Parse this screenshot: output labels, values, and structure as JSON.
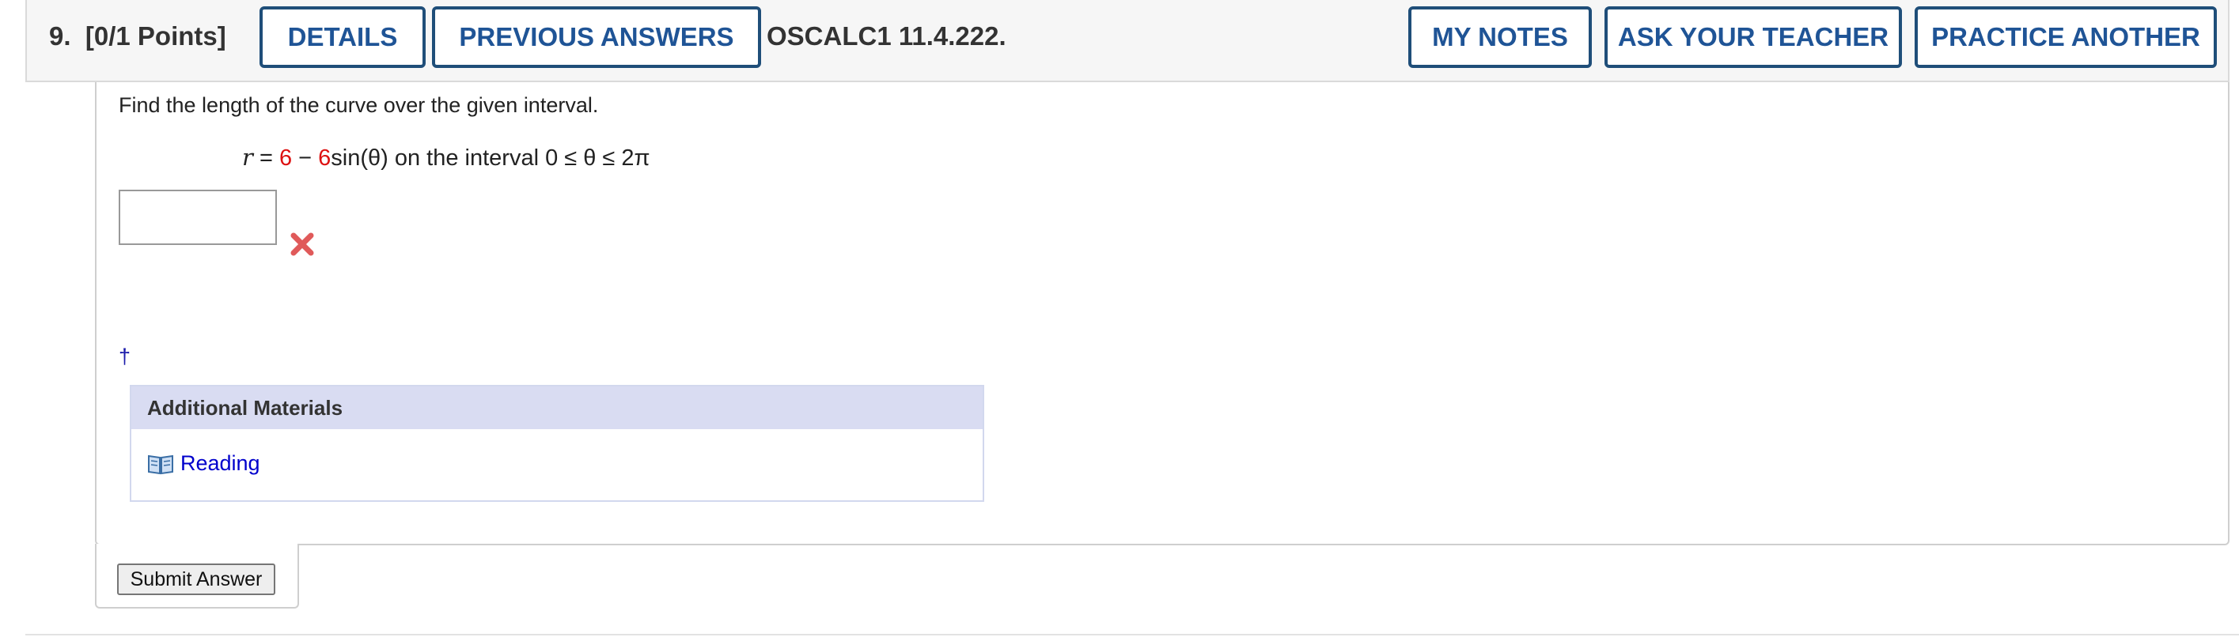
{
  "header": {
    "question_number": "9.",
    "points": "[0/1 Points]",
    "details_label": "DETAILS",
    "previous_answers_label": "PREVIOUS ANSWERS",
    "code": "OSCALC1 11.4.222.",
    "my_notes_label": "MY NOTES",
    "ask_teacher_label": "ASK YOUR TEACHER",
    "practice_another_label": "PRACTICE ANOTHER"
  },
  "question": {
    "prompt": "Find the length of the curve over the given interval.",
    "equation": {
      "variable": "r",
      "equals": "=",
      "a": "6",
      "minus": "−",
      "b": "6",
      "function": "sin(θ)",
      "interval_text": "on the interval 0 ≤ θ ≤ 2π"
    },
    "answer_value": "",
    "answer_status": "incorrect",
    "status_icon": "x-mark-icon",
    "dagger": "†"
  },
  "materials": {
    "heading": "Additional Materials",
    "reading_icon": "book-icon",
    "reading_label": "Reading"
  },
  "actions": {
    "submit_label": "Submit Answer"
  },
  "colors": {
    "button_border": "#1f4e79",
    "button_text": "#1f5496",
    "error_red": "#e05a5a",
    "equation_red": "#d11",
    "materials_header_bg": "#d9dcf2",
    "link_blue": "#0000cc"
  }
}
